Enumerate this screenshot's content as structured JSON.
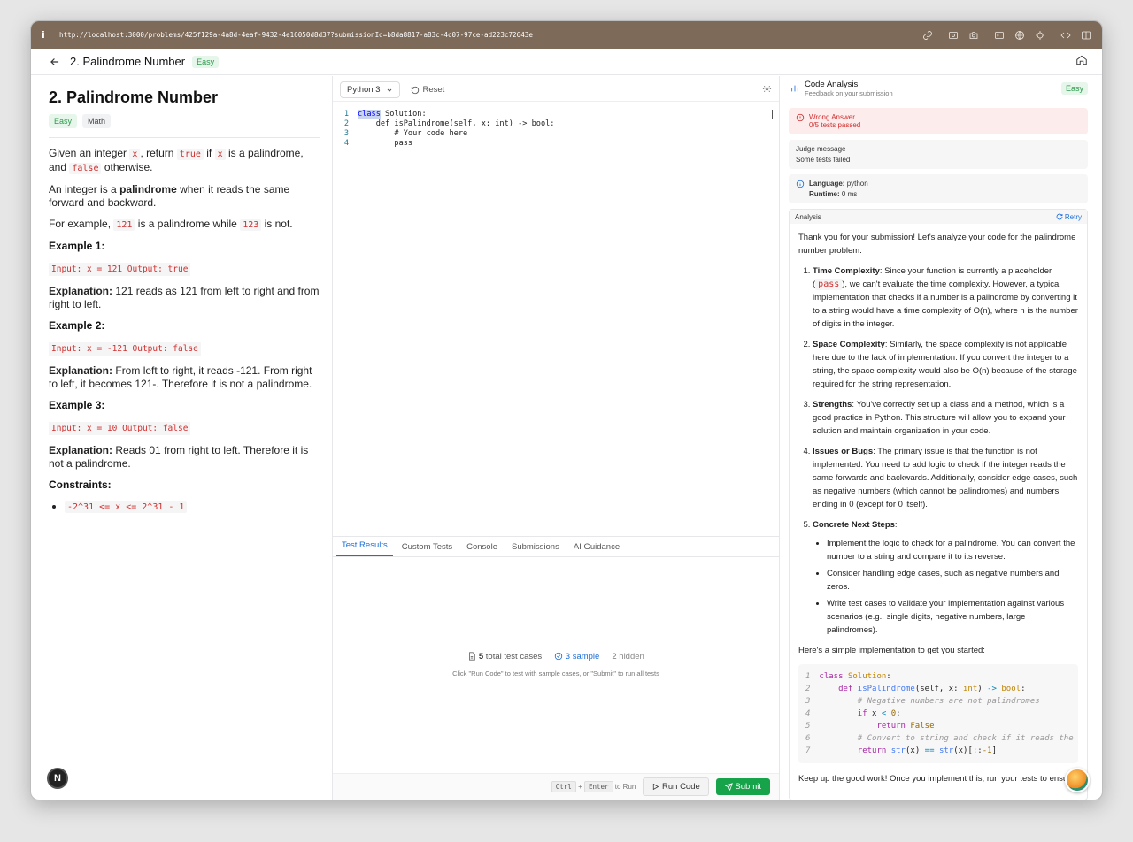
{
  "browser": {
    "info": "i",
    "url": "http://localhost:3000/problems/425f129a-4a8d-4eaf-9432-4e16050d8d37?submissionId=b8da8817-a83c-4c07-97ce-ad223c72643e"
  },
  "header": {
    "title": "2. Palindrome Number",
    "difficulty": "Easy"
  },
  "problem": {
    "title": "2. Palindrome Number",
    "tags": [
      "Easy",
      "Math"
    ],
    "p1a": "Given an integer",
    "p1x": "x",
    "p1b": ", return",
    "p1true": "true",
    "p1c": "if",
    "p1x2": "x",
    "p1d": "is a palindrome, and",
    "p1false": "false",
    "p1e": "otherwise.",
    "p2a": "An integer is a",
    "p2b": "palindrome",
    "p2c": "when it reads the same forward and backward.",
    "p3a": "For example,",
    "p3b": "121",
    "p3c": "is a palindrome while",
    "p3d": "123",
    "p3e": "is not.",
    "examples": [
      {
        "title": "Example 1:",
        "io": "Input: x = 121 Output: true",
        "label": "Explanation:",
        "text": "121 reads as 121 from left to right and from right to left."
      },
      {
        "title": "Example 2:",
        "io": "Input: x = -121 Output: false",
        "label": "Explanation:",
        "text": "From left to right, it reads -121. From right to left, it becomes 121-. Therefore it is not a palindrome."
      },
      {
        "title": "Example 3:",
        "io": "Input: x = 10 Output: false",
        "label": "Explanation:",
        "text": "Reads 01 from right to left. Therefore it is not a palindrome."
      }
    ],
    "constraints_title": "Constraints:",
    "constraint": "-2^31 <= x <= 2^31 - 1"
  },
  "next_badge": "N",
  "editor": {
    "language": "Python 3",
    "reset": "Reset",
    "lines": [
      {
        "n": "1",
        "kw": "class",
        "rest": " Solution:"
      },
      {
        "n": "2",
        "code": "    def isPalindrome(self, x: int) -> bool:"
      },
      {
        "n": "3",
        "comment": "        # Your code here"
      },
      {
        "n": "4",
        "code": "        pass"
      }
    ]
  },
  "panel": {
    "tabs": [
      "Test Results",
      "Custom Tests",
      "Console",
      "Submissions",
      "AI Guidance"
    ],
    "total_count": "5",
    "total_label": "total test cases",
    "sample": "3 sample",
    "hidden_count": "2",
    "hidden_label": "hidden",
    "hint": "Click \"Run Code\" to test with sample cases, or \"Submit\" to run all tests"
  },
  "footer": {
    "key1": "Ctrl",
    "plus": "+",
    "key2": "Enter",
    "to_run": "to Run",
    "run": "Run Code",
    "submit": "Submit"
  },
  "analysis": {
    "title": "Code Analysis",
    "subtitle": "Feedback on your submission",
    "difficulty": "Easy",
    "verdict": "Wrong Answer",
    "passed": "0/5 tests passed",
    "judge_label": "Judge message",
    "judge_text": "Some tests failed",
    "lang_label": "Language:",
    "lang_value": "python",
    "runtime_label": "Runtime:",
    "runtime_value": "0 ms",
    "section": "Analysis",
    "retry": "Retry",
    "intro": "Thank you for your submission! Let's analyze your code for the palindrome number problem.",
    "points": [
      {
        "title": "Time Complexity",
        "pre": ": Since your function is currently a placeholder (",
        "code": "pass",
        "post": "), we can't evaluate the time complexity. However, a typical implementation that checks if a number is a palindrome by converting it to a string would have a time complexity of O(n), where n is the number of digits in the integer."
      },
      {
        "title": "Space Complexity",
        "pre": ": Similarly, the space complexity is not applicable here due to the lack of implementation. If you convert the integer to a string, the space complexity would also be O(n) because of the storage required for the string representation.",
        "code": "",
        "post": ""
      },
      {
        "title": "Strengths",
        "pre": ": You've correctly set up a class and a method, which is a good practice in Python. This structure will allow you to expand your solution and maintain organization in your code.",
        "code": "",
        "post": ""
      },
      {
        "title": "Issues or Bugs",
        "pre": ": The primary issue is that the function is not implemented. You need to add logic to check if the integer reads the same forwards and backwards. Additionally, consider edge cases, such as negative numbers (which cannot be palindromes) and numbers ending in 0 (except for 0 itself).",
        "code": "",
        "post": ""
      },
      {
        "title": "Concrete Next Steps",
        "pre": ":",
        "code": "",
        "post": ""
      }
    ],
    "steps": [
      "Implement the logic to check for a palindrome. You can convert the number to a string and compare it to its reverse.",
      "Consider handling edge cases, such as negative numbers and zeros.",
      "Write test cases to validate your implementation against various scenarios (e.g., single digits, negative numbers, large palindromes)."
    ],
    "impl_intro": "Here's a simple implementation to get you started:",
    "code_lines": [
      "1",
      "2",
      "3",
      "4",
      "5",
      "6",
      "7"
    ],
    "outro": "Keep up the good work! Once you implement this, run your tests to ensure"
  }
}
